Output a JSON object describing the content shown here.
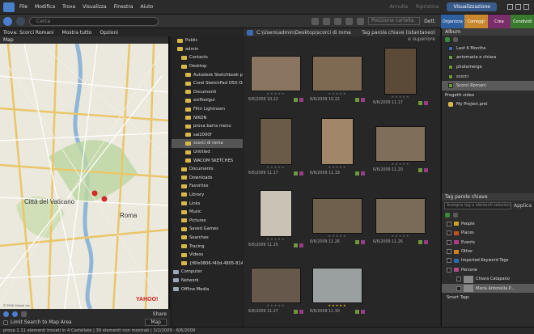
{
  "menubar": {
    "items": [
      "File",
      "Modifica",
      "Trova",
      "Visualizza",
      "Finestra",
      "Aiuto"
    ],
    "undo": "Annulla",
    "redo": "Ripristina",
    "view_label": "Visualizzazione"
  },
  "toolbar": {
    "search_placeholder": "Cerca",
    "position_label": "Posizione cartella",
    "details_label": "Dett."
  },
  "tabs": [
    {
      "label": "Organizza",
      "color": "#2e5f9e"
    },
    {
      "label": "Correggi",
      "color": "#c9872e"
    },
    {
      "label": "Crea",
      "color": "#7a2f6a"
    },
    {
      "label": "Condividi",
      "color": "#3a7a2e"
    }
  ],
  "breadcrumb": {
    "find": "Trova: Scorci Romani",
    "show_all": "Mostra tutto",
    "options": "Opzioni"
  },
  "map": {
    "header": "Map",
    "place_vatican": "Città del Vaticano",
    "place_roma": "Roma",
    "credit": "YAHOO!",
    "copyright": "© 2006 Yahoo! Inc.",
    "limit_label": "Limit Search to Map Area",
    "share": "Share",
    "maptype": "Map"
  },
  "folders": [
    {
      "label": "Public",
      "indent": 1
    },
    {
      "label": "admin",
      "indent": 1
    },
    {
      "label": "Contacts",
      "indent": 2
    },
    {
      "label": "Desktop",
      "indent": 2
    },
    {
      "label": "Autodesk Sketchbook p...",
      "indent": 3
    },
    {
      "label": "Corel SketchPad OSX Ori...",
      "indent": 3
    },
    {
      "label": "Documenti",
      "indent": 3
    },
    {
      "label": "exifloolgui",
      "indent": 3
    },
    {
      "label": "Filtri Lightroom",
      "indent": 3
    },
    {
      "label": "NIKON",
      "indent": 3
    },
    {
      "label": "prova barra menu",
      "indent": 3
    },
    {
      "label": "sai2000f",
      "indent": 3
    },
    {
      "label": "scorci di roma",
      "indent": 3,
      "selected": true
    },
    {
      "label": "Untitled",
      "indent": 3
    },
    {
      "label": "WACOM SKETCHES",
      "indent": 3
    },
    {
      "label": "Documents",
      "indent": 2
    },
    {
      "label": "Downloads",
      "indent": 2
    },
    {
      "label": "Favorites",
      "indent": 2
    },
    {
      "label": "Library",
      "indent": 2
    },
    {
      "label": "Links",
      "indent": 2
    },
    {
      "label": "Music",
      "indent": 2
    },
    {
      "label": "Pictures",
      "indent": 2
    },
    {
      "label": "Saved Games",
      "indent": 2
    },
    {
      "label": "Searches",
      "indent": 2
    },
    {
      "label": "Tracing",
      "indent": 2
    },
    {
      "label": "Videos",
      "indent": 2
    },
    {
      "label": "{f6fe0806-f40d-4805-814f-1f...",
      "indent": 2
    },
    {
      "label": "Computer",
      "indent": 0
    },
    {
      "label": "Network",
      "indent": 0
    },
    {
      "label": "Offline Media",
      "indent": 0
    }
  ],
  "browser": {
    "path": "C:\\Users\\admin\\Desktop\\scorci di roma",
    "tag_filter": "Tag parola chiave (istantaneo)",
    "sort": "e superiore"
  },
  "thumbs": [
    {
      "date": "6/6/2009 10.22",
      "stars": "★★★★★",
      "gold": false,
      "kind": "wide"
    },
    {
      "date": "6/6/2009 10.22",
      "stars": "★★★★★",
      "gold": false,
      "kind": "wide"
    },
    {
      "date": "6/6/2009 11.17",
      "stars": "★★★★★",
      "gold": false,
      "kind": "tall"
    },
    {
      "date": "6/6/2009 11.17",
      "stars": "★★★★★",
      "gold": false,
      "kind": "tall"
    },
    {
      "date": "6/6/2009 11.19",
      "stars": "★★★★★",
      "gold": false,
      "kind": "tall"
    },
    {
      "date": "6/6/2009 11.20",
      "stars": "★★★★★",
      "gold": false,
      "kind": "wide"
    },
    {
      "date": "6/6/2009 11.25",
      "stars": "★★★★★",
      "gold": false,
      "kind": "tall"
    },
    {
      "date": "6/6/2009 11.26",
      "stars": "★★★★★",
      "gold": false,
      "kind": "wide"
    },
    {
      "date": "6/6/2009 11.26",
      "stars": "★★★★★",
      "gold": false,
      "kind": "wide"
    },
    {
      "date": "6/6/2009 11.27",
      "stars": "★★★★★",
      "gold": false,
      "kind": "wide"
    },
    {
      "date": "6/6/2009 11.30",
      "stars": "★★★★★",
      "gold": true,
      "kind": "wide"
    }
  ],
  "album": {
    "header": "Album",
    "items": [
      "Last 6 Months",
      "antomaria e chiara",
      "photomerge",
      "scorci",
      "Scorci Romani"
    ],
    "selected": "Scorci Romani",
    "projects_label": "Progetti video",
    "project_item": "My Project.prel"
  },
  "tags": {
    "header": "Tag parole chiave",
    "input_placeholder": "Assegna tag a elementi selezionati",
    "apply": "Applica",
    "items": [
      {
        "label": "People",
        "color": "#d0a020",
        "indent": 0
      },
      {
        "label": "Places",
        "color": "#c85020",
        "indent": 0
      },
      {
        "label": "Events",
        "color": "#b03a8a",
        "indent": 0
      },
      {
        "label": "Other",
        "color": "#d08020",
        "indent": 0
      },
      {
        "label": "Imported Keyword Tags",
        "color": "#2a6ab0",
        "indent": 0
      },
      {
        "label": "Persone",
        "color": "#b04a8a",
        "indent": 0
      },
      {
        "label": "Chiara Catapano",
        "color": "#888",
        "indent": 1
      },
      {
        "label": "Maria Antonella P...",
        "color": "#888",
        "indent": 1
      }
    ],
    "selected": "Maria Antonella P...",
    "smart": "Smart Tags"
  },
  "status": {
    "text": "prova 1    11 elementi trovati in 4 Cartellate  |  39 elementi non mostrati  |  3/2/2009 - 6/6/2009"
  }
}
